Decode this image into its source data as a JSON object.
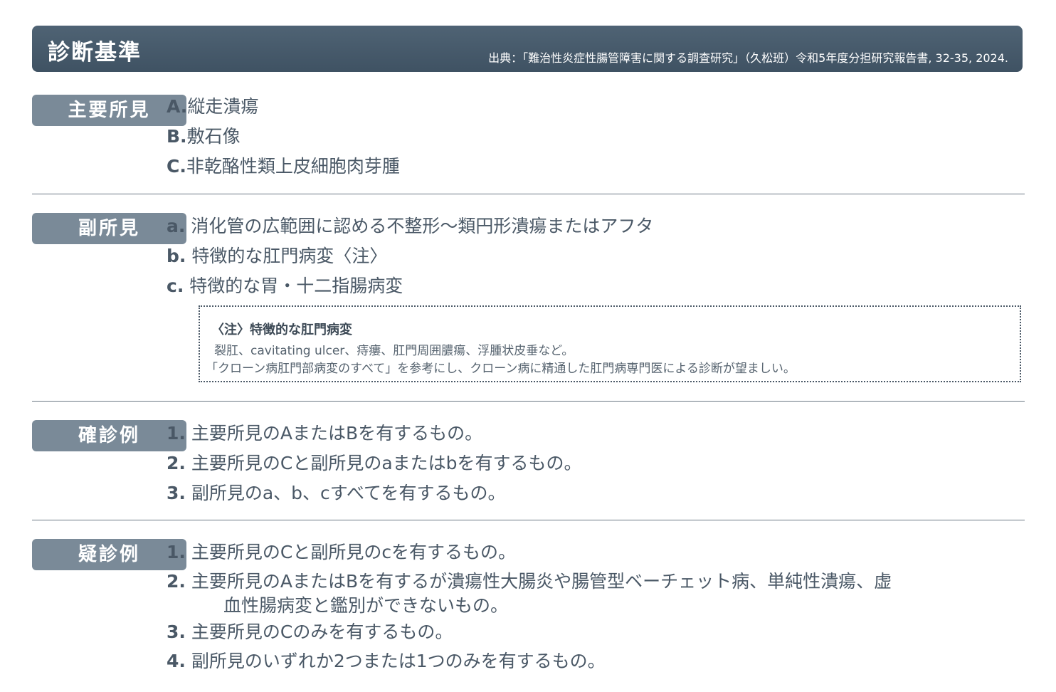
{
  "header": {
    "title": "診断基準",
    "source": "出典：「難治性炎症性腸管障害に関する調査研究」（久松班）令和5年度分担研究報告書, 32-35, 2024."
  },
  "major": {
    "label": "主要所見",
    "items": [
      {
        "key": "A.",
        "text": "縦走潰瘍"
      },
      {
        "key": "B.",
        "text": "敷石像"
      },
      {
        "key": "C.",
        "text": "非乾酪性類上皮細胞肉芽腫"
      }
    ]
  },
  "minor": {
    "label": "副所見",
    "items": [
      {
        "key": "a.",
        "text": "消化管の広範囲に認める不整形～類円形潰瘍またはアフタ"
      },
      {
        "key": "b.",
        "text": "特徴的な肛門病変〈注〉"
      },
      {
        "key": "c.",
        "text": "特徴的な胃・十二指腸病変"
      }
    ],
    "note": {
      "title": "〈注〉特徴的な肛門病変",
      "line1": "裂肛、cavitating ulcer、痔瘻、肛門周囲膿瘍、浮腫状皮垂など。",
      "line2": "「クローン病肛門部病変のすべて」を参考にし、クローン病に精通した肛門病専門医による診断が望ましい。"
    }
  },
  "definite": {
    "label": "確診例",
    "items": [
      {
        "key": "1.",
        "text": "主要所見のAまたはBを有するもの。"
      },
      {
        "key": "2.",
        "text": "主要所見のCと副所見のaまたはbを有するもの。"
      },
      {
        "key": "3.",
        "text": "副所見のa、b、cすべてを有するもの。"
      }
    ]
  },
  "suspected": {
    "label": "疑診例",
    "items": [
      {
        "key": "1.",
        "text": "主要所見のCと副所見のcを有するもの。"
      },
      {
        "key": "2.",
        "text": "主要所見のAまたはBを有するが潰瘍性大腸炎や腸管型ベーチェット病、単純性潰瘍、虚",
        "text2": "血性腸病変と鑑別ができないもの。"
      },
      {
        "key": "3.",
        "text": "主要所見のCのみを有するもの。"
      },
      {
        "key": "4.",
        "text": "副所見のいずれか2つまたは1つのみを有するもの。"
      }
    ]
  }
}
